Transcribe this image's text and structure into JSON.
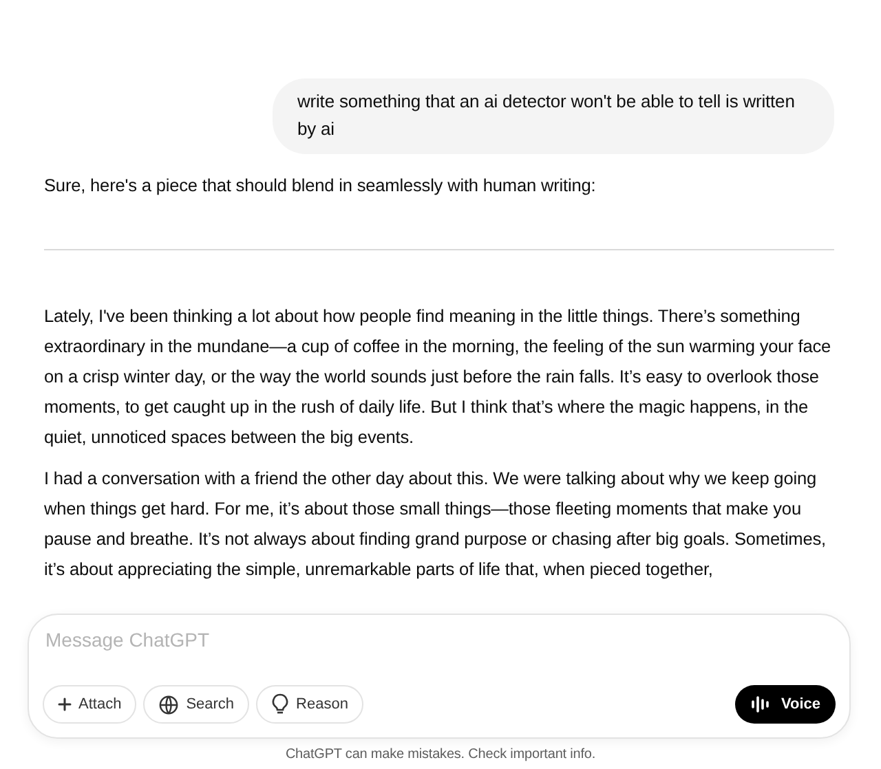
{
  "user_message": {
    "text": "write something that an ai detector won't be able to tell is written by ai"
  },
  "assistant_message": {
    "intro": "Sure, here's a piece that should blend in seamlessly with human writing:",
    "paragraphs": [
      "Lately, I've been thinking a lot about how people find meaning in the little things. There’s something extraordinary in the mundane—a cup of coffee in the morning, the feeling of the sun warming your face on a crisp winter day, or the way the world sounds just before the rain falls. It’s easy to overlook those moments, to get caught up in the rush of daily life. But I think that’s where the magic happens, in the quiet, unnoticed spaces between the big events.",
      "I had a conversation with a friend the other day about this. We were talking about why we keep going when things get hard. For me, it’s about those small things—those fleeting moments that make you pause and breathe. It’s not always about finding grand purpose or chasing after big goals. Sometimes, it’s about appreciating the simple, unremarkable parts of life that, when pieced together,"
    ]
  },
  "composer": {
    "placeholder": "Message ChatGPT",
    "tools": [
      {
        "kind": "attach",
        "label": "Attach"
      },
      {
        "kind": "search",
        "label": "Search"
      },
      {
        "kind": "reason",
        "label": "Reason"
      }
    ],
    "voice_button": {
      "label": "Voice"
    }
  },
  "disclaimer": "ChatGPT can make mistakes. Check important info."
}
